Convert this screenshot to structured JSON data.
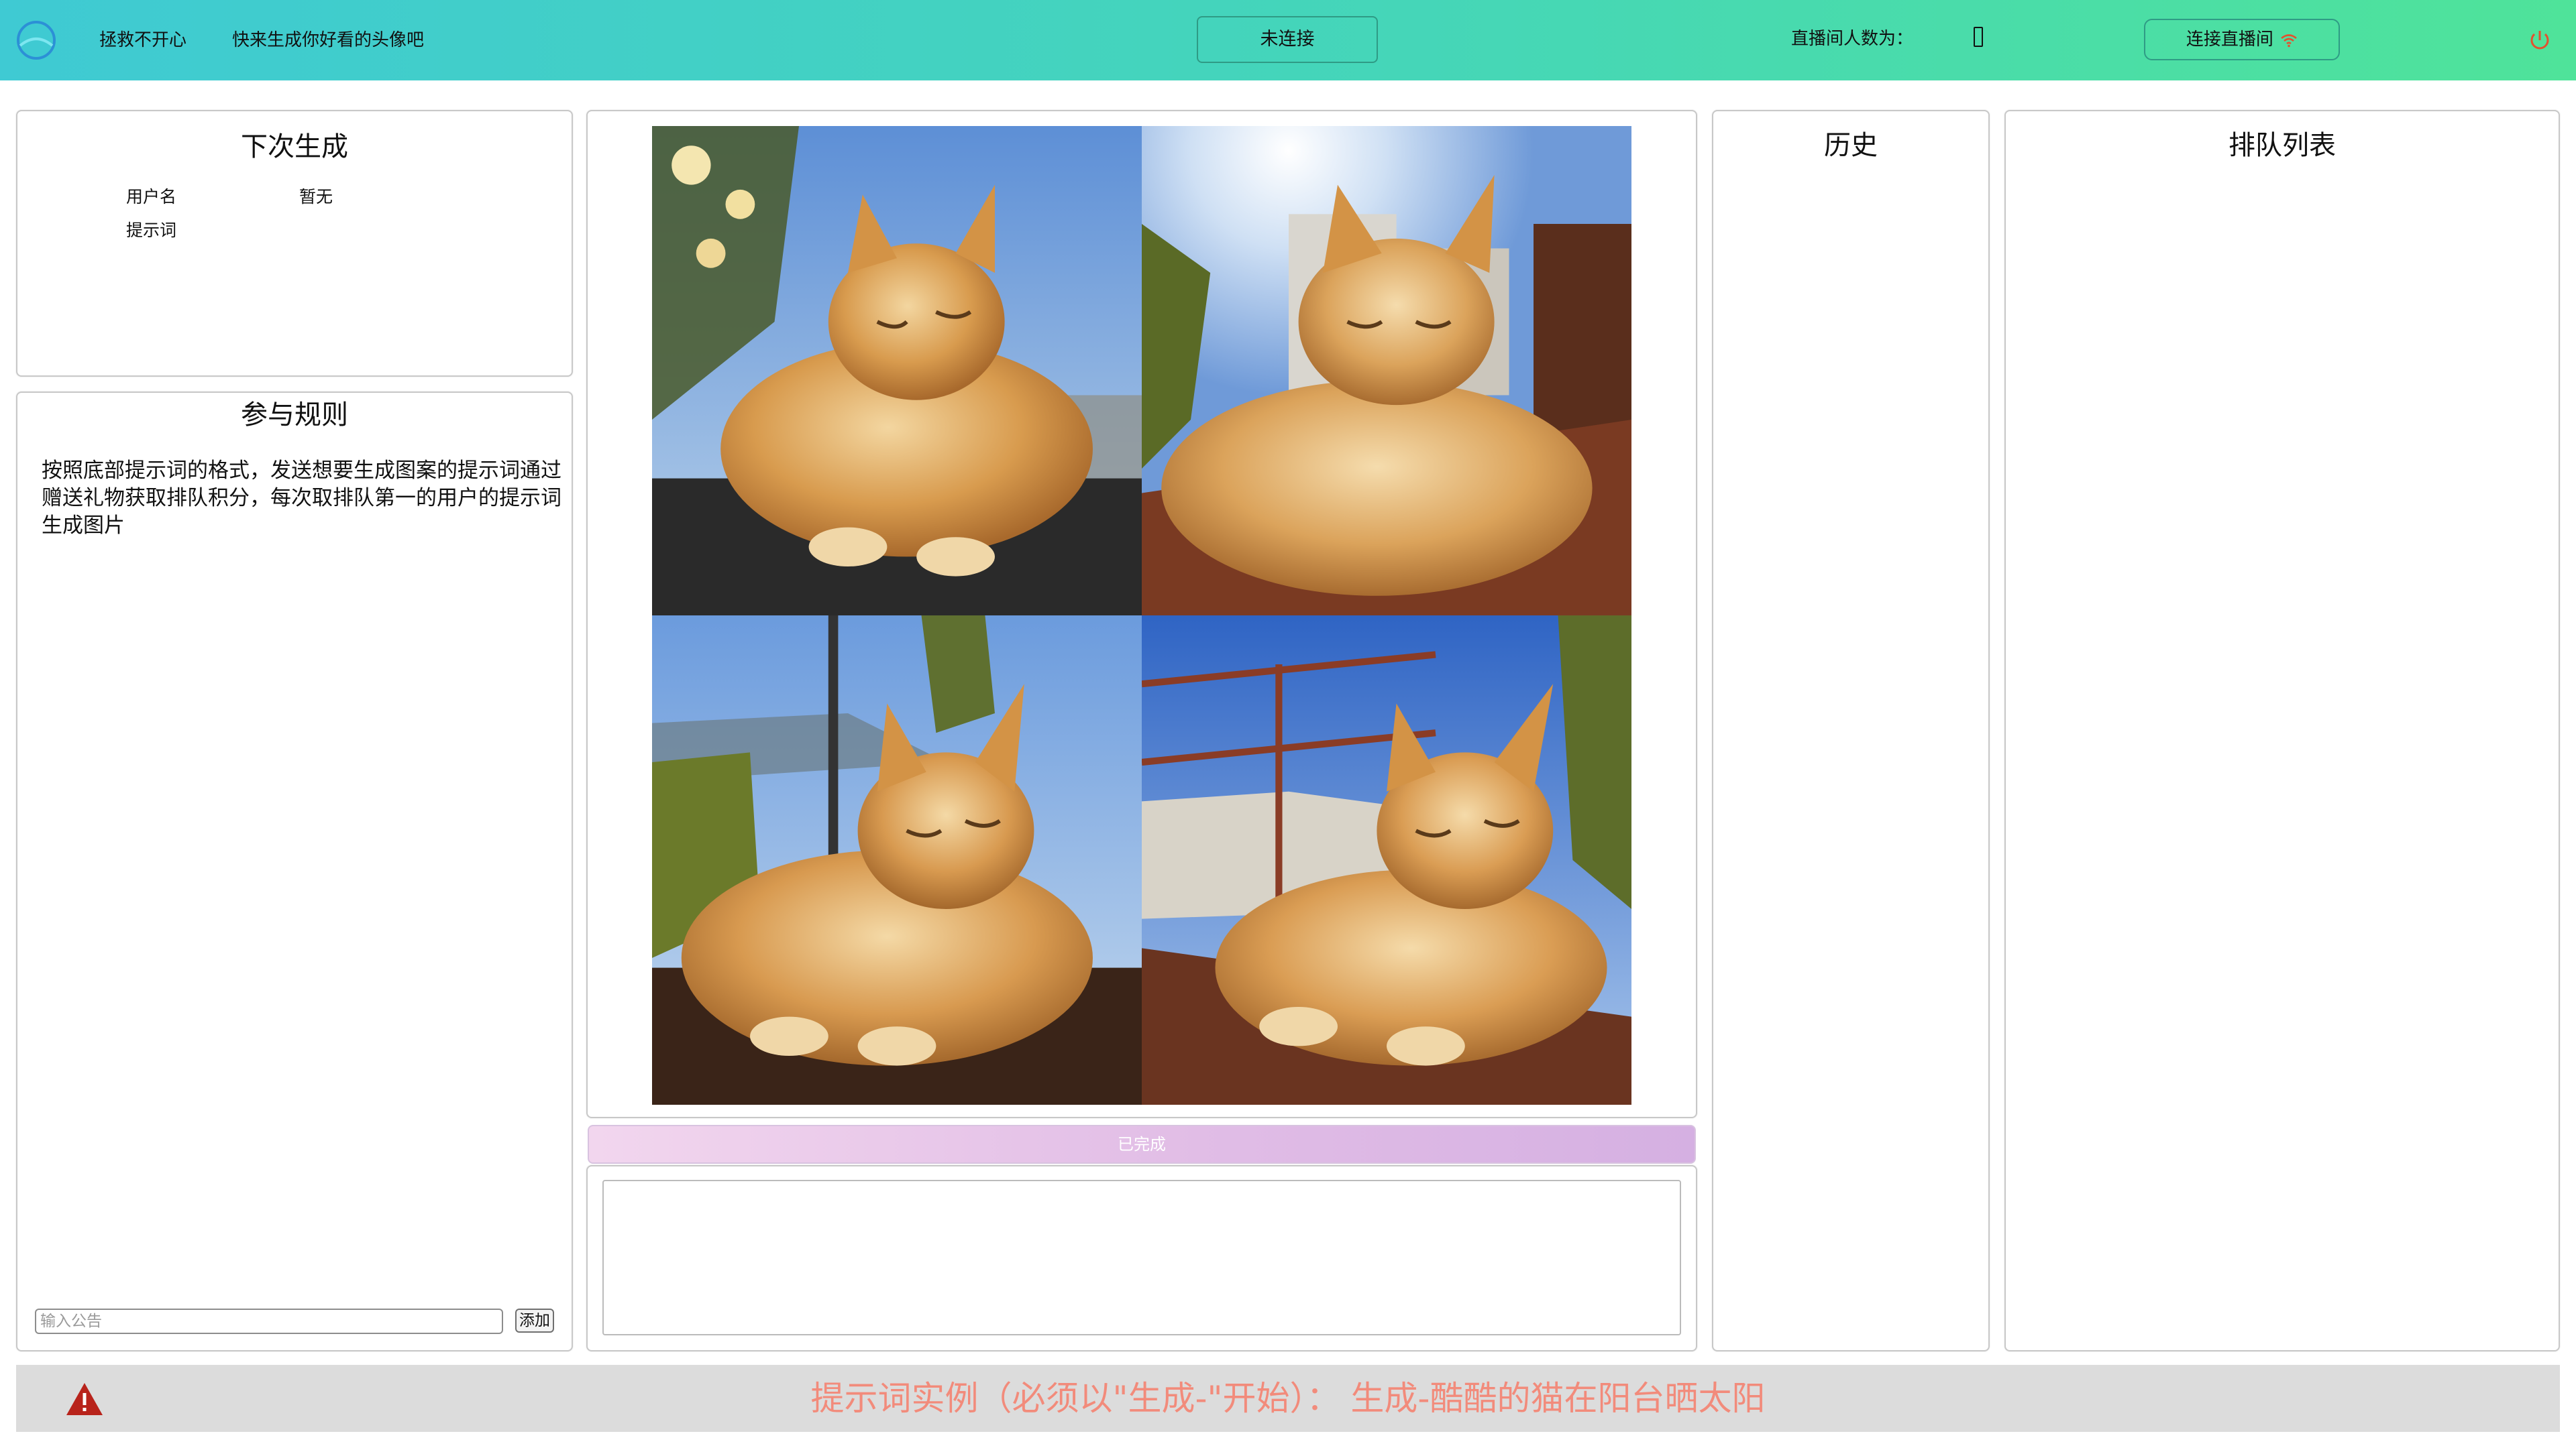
{
  "header": {
    "nav": [
      "拯救不开心",
      "快来生成你好看的头像吧"
    ],
    "connection_status": "未连接",
    "viewer_label": "直播间人数为：",
    "connect_button": "连接直播间"
  },
  "next_generation": {
    "title": "下次生成",
    "username_label": "用户名",
    "username_value": "暂无",
    "prompt_label": "提示词"
  },
  "rules": {
    "title": "参与规则",
    "text": "按照底部提示词的格式，发送想要生成图案的提示词通过赠送礼物获取排队积分，每次取排队第一的用户的提示词生成图片",
    "notice_placeholder": "输入公告",
    "add_button": "添加"
  },
  "image_panel": {
    "progress_label": "已完成",
    "progress": 1.0
  },
  "history": {
    "title": "历史"
  },
  "queue": {
    "title": "排队列表"
  },
  "footer": {
    "example_text": "提示词实例（必须以\"生成-\"开始）：  生成-酷酷的猫在阳台晒太阳"
  },
  "colors": {
    "header_start": "#3fcad3",
    "header_end": "#4fe39a",
    "footer_text": "#f28b7b",
    "warning": "#b8231b"
  },
  "icons": [
    "logo-icon",
    "wifi-icon",
    "power-icon",
    "warning-icon"
  ]
}
